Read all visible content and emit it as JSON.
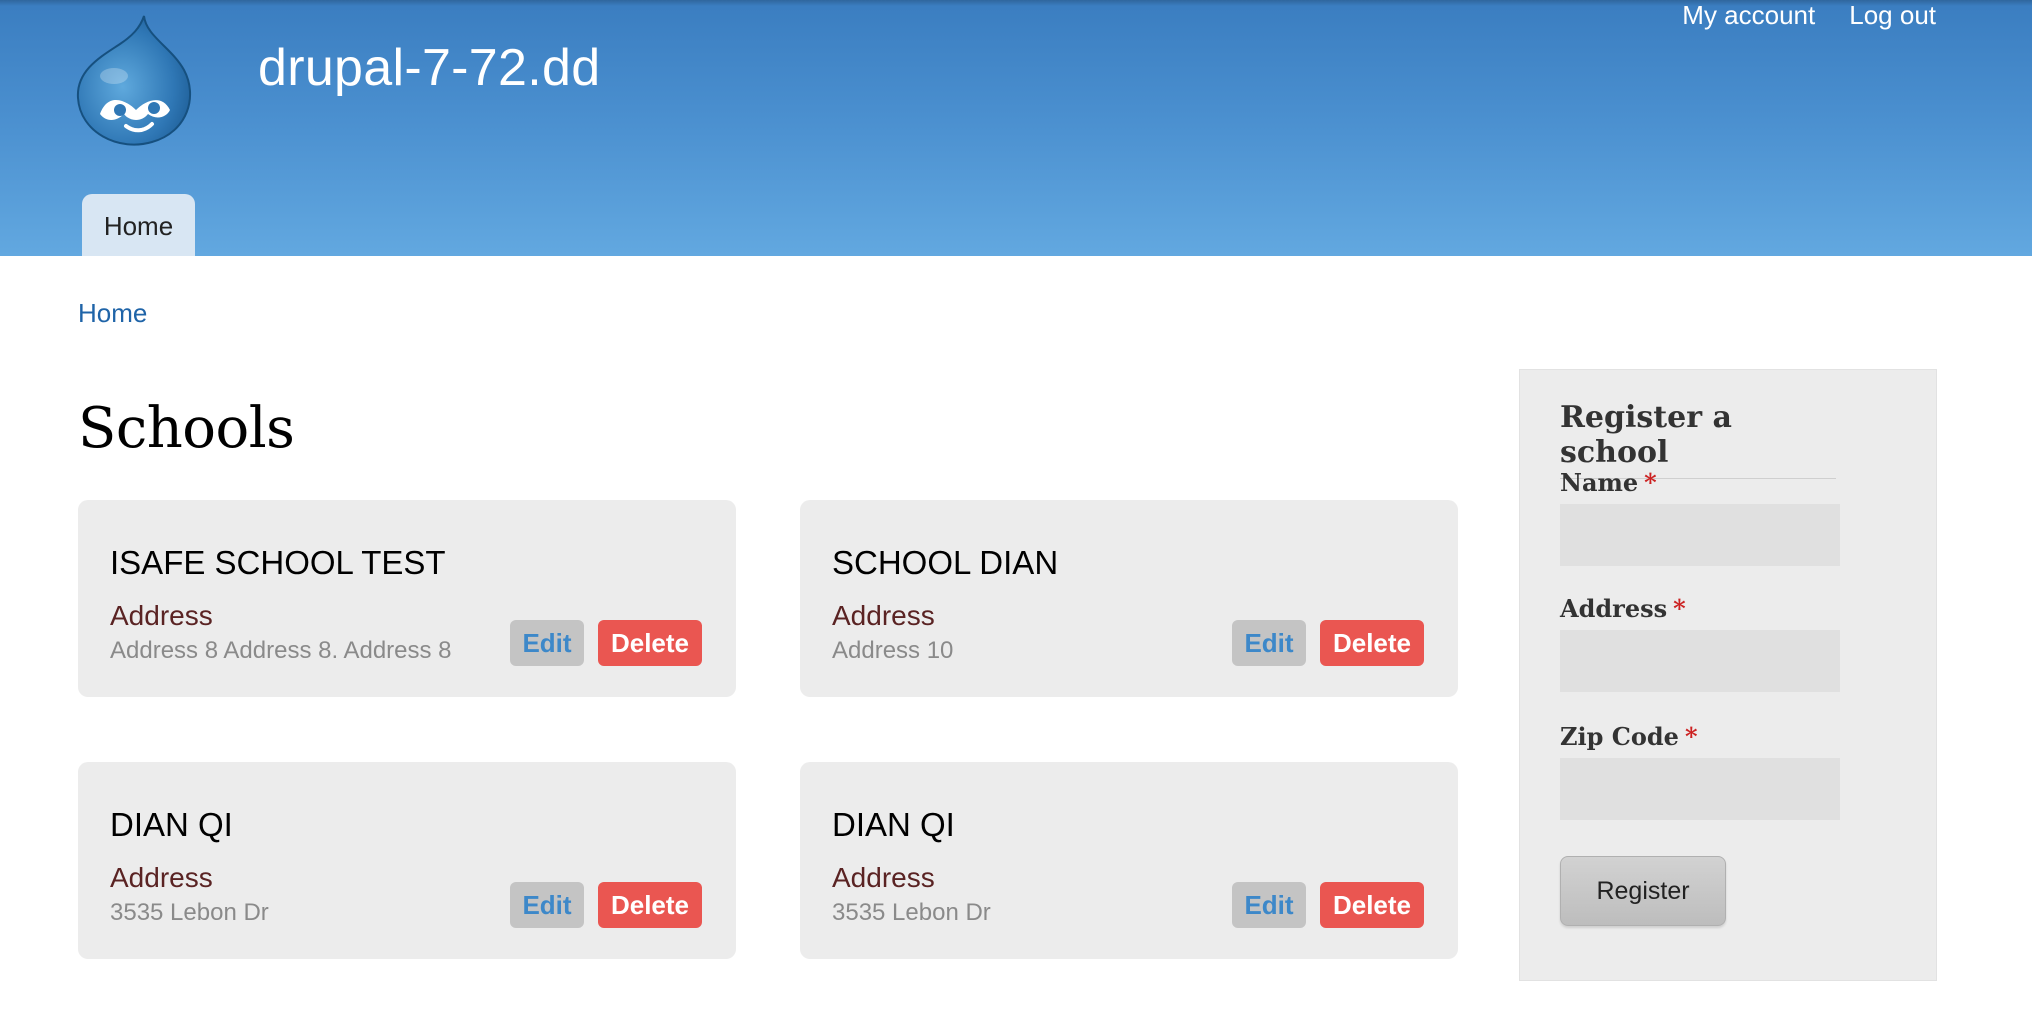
{
  "site": {
    "name": "drupal-7-72.dd"
  },
  "secondary_menu": [
    "My account",
    "Log out"
  ],
  "main_menu": {
    "home": "Home"
  },
  "breadcrumb": "Home",
  "page": {
    "title": "Schools"
  },
  "schools": [
    {
      "name": "ISAFE SCHOOL TEST",
      "address_label": "Address",
      "address": "Address 8 Address 8. Address 8",
      "edit": "Edit",
      "delete": "Delete"
    },
    {
      "name": "SCHOOL DIAN",
      "address_label": "Address",
      "address": "Address 10",
      "edit": "Edit",
      "delete": "Delete"
    },
    {
      "name": "DIAN QI",
      "address_label": "Address",
      "address": "3535 Lebon Dr",
      "edit": "Edit",
      "delete": "Delete"
    },
    {
      "name": "DIAN QI",
      "address_label": "Address",
      "address": "3535 Lebon Dr",
      "edit": "Edit",
      "delete": "Delete"
    }
  ],
  "register_form": {
    "title": "Register a school",
    "fields": [
      {
        "label": "Name",
        "required": "*",
        "value": ""
      },
      {
        "label": "Address",
        "required": "*",
        "value": ""
      },
      {
        "label": "Zip Code",
        "required": "*",
        "value": ""
      }
    ],
    "submit": "Register"
  },
  "colors": {
    "header_top": "#3a7dc0",
    "header_bottom": "#62a8e0",
    "edit_text": "#3d88c9",
    "delete_bg": "#ea5651",
    "address_label": "#5a2323"
  },
  "icons": {
    "logo": "drupal-drop-logo-icon"
  }
}
